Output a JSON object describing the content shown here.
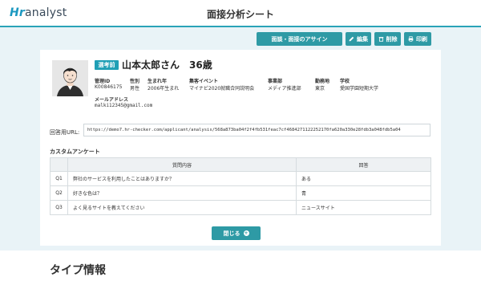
{
  "app": {
    "logo_prefix": "Hr",
    "logo_suffix": "analyst",
    "page_title": "面接分析シート"
  },
  "toolbar": {
    "assign_label": "面談・面接のアサイン",
    "edit_label": "編集",
    "delete_label": "削除",
    "print_label": "印刷"
  },
  "applicant": {
    "badge": "選考前",
    "name": "山本太郎さん　36歳",
    "fields": {
      "manage_id_label": "管理ID",
      "manage_id": "K00846175",
      "gender_label": "性別",
      "gender": "男性",
      "birth_label": "生まれ年",
      "birth": "2006年生まれ",
      "event_label": "集客イベント",
      "event": "マイナビ2020就職合同説明会",
      "dept_label": "事業部",
      "dept": "メディア推進部",
      "location_label": "勤務地",
      "location": "東京",
      "school_label": "学校",
      "school": "愛国学園短期大学",
      "email_label": "メールアドレス",
      "email": "malki12345@gmail.com"
    }
  },
  "answer_url": {
    "label": "回答用URL:",
    "value": "https://demo7.hr-checker.com/applicant/analysis/568a873ba04f2f4fb531feac7cf4684271122252170fa620a330e28fdb3a048fdb5a04"
  },
  "survey": {
    "title": "カスタムアンケート",
    "headers": [
      "",
      "質問内容",
      "回答"
    ],
    "rows": [
      {
        "num": "Q1",
        "question": "弊社のサービスを利用したことはありますか？",
        "answer": "ある"
      },
      {
        "num": "Q2",
        "question": "好きな色は？",
        "answer": "青"
      },
      {
        "num": "Q3",
        "question": "よく見るサイトを教えてください",
        "answer": "ニュースサイト"
      }
    ]
  },
  "close_label": "閉じる",
  "section": {
    "type_info": "タイプ情報"
  },
  "colors": {
    "accent": "#2e9aa5",
    "badge": "#1f9fb5",
    "background": "#e9f3f7"
  }
}
